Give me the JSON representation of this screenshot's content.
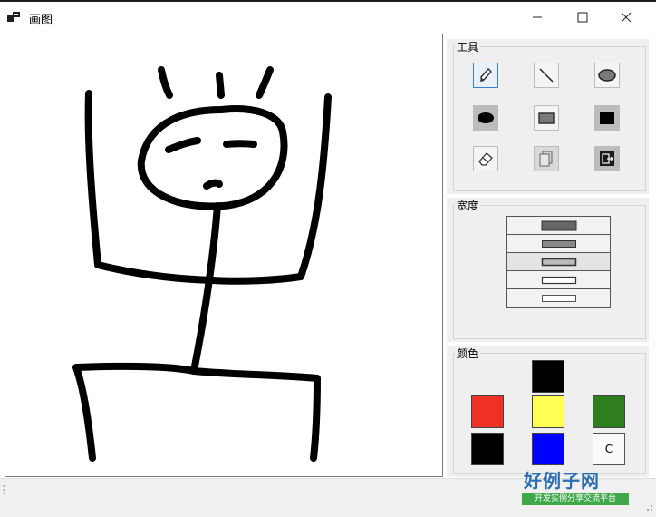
{
  "window": {
    "title": "画图",
    "minimize_icon": "minimize-icon",
    "maximize_icon": "maximize-icon",
    "close_icon": "close-icon"
  },
  "tools_group": {
    "label": "工具",
    "tools": [
      {
        "name": "pencil",
        "icon": "pencil-icon",
        "selected": true
      },
      {
        "name": "line",
        "icon": "line-icon",
        "selected": false
      },
      {
        "name": "ellipse",
        "icon": "ellipse-icon",
        "selected": false
      },
      {
        "name": "filled-ellipse",
        "icon": "filled-ellipse-icon",
        "selected": false
      },
      {
        "name": "rectangle",
        "icon": "rectangle-icon",
        "selected": false
      },
      {
        "name": "filled-rectangle",
        "icon": "filled-rectangle-icon",
        "selected": false
      },
      {
        "name": "eraser",
        "icon": "eraser-icon",
        "selected": false
      },
      {
        "name": "new",
        "icon": "new-page-icon",
        "selected": false
      },
      {
        "name": "exit",
        "icon": "exit-icon",
        "selected": false
      }
    ]
  },
  "width_group": {
    "label": "宽度",
    "widths": [
      5,
      4,
      3,
      2,
      1
    ]
  },
  "color_group": {
    "label": "颜色",
    "current_color": "#000000",
    "palette": [
      "#ee3124",
      "#ffff55",
      "#2e7d1f",
      "#000000",
      "#0000ff"
    ],
    "custom_label": "C"
  },
  "watermark": {
    "title": "好例子网",
    "subtitle": "开发实例分享交流平台"
  },
  "colors": {
    "panel_bg": "#efefef",
    "selected_border": "#3a7fd6",
    "ink": "#000000"
  }
}
